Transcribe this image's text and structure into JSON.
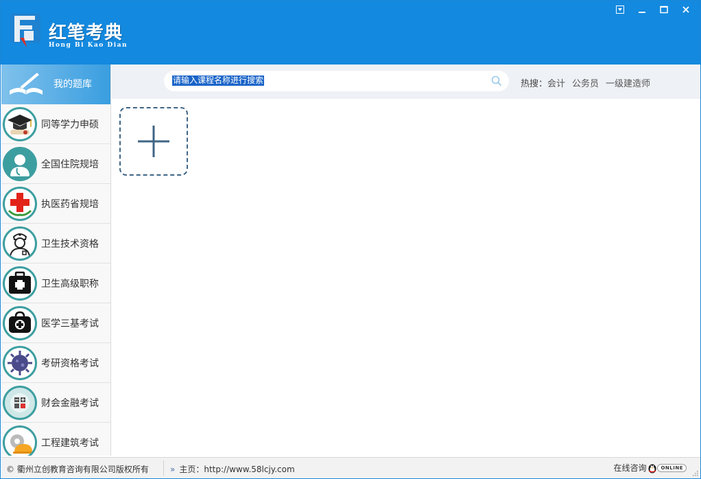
{
  "app": {
    "brand_title": "红笔考典",
    "brand_subtitle": "Hong Bi Kao Dian"
  },
  "window_controls": {
    "menu": "menu-dropdown",
    "minimize": "minimize",
    "maximize": "maximize",
    "close": "close"
  },
  "sidebar": {
    "header_label": "我的题库",
    "items": [
      {
        "label": "同等学力申硕",
        "icon": "graduation-cap-icon"
      },
      {
        "label": "全国住院规培",
        "icon": "doctor-icon"
      },
      {
        "label": "执医药省规培",
        "icon": "red-cross-icon"
      },
      {
        "label": "卫生技术资格",
        "icon": "nurse-icon"
      },
      {
        "label": "卫生高级职称",
        "icon": "first-aid-kit-icon"
      },
      {
        "label": "医学三基考试",
        "icon": "medical-bag-icon"
      },
      {
        "label": "考研资格考试",
        "icon": "virus-icon"
      },
      {
        "label": "财会金融考试",
        "icon": "calculator-icon"
      },
      {
        "label": "工程建筑考试",
        "icon": "hardhat-gear-icon"
      }
    ]
  },
  "search": {
    "placeholder": "请输入课程名称进行搜索"
  },
  "hot_search": {
    "label": "热搜：",
    "links": [
      "会计",
      "公务员",
      "一级建造师"
    ]
  },
  "footer": {
    "copyright": "© 衢州立创教育咨询有限公司版权所有",
    "home_label": "主页：http://www.58lcjy.com",
    "online_label": "在线咨询",
    "online_badge": "ONLINE"
  },
  "colors": {
    "header_blue": "#1389df",
    "ring_teal": "#3d9ea0"
  }
}
